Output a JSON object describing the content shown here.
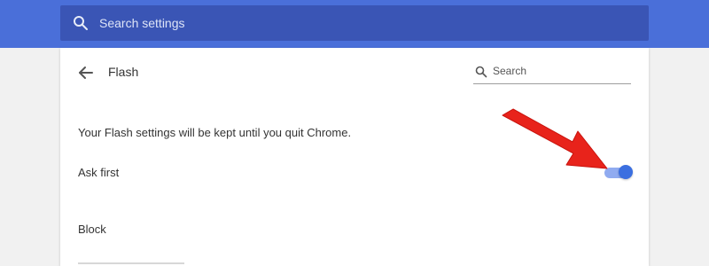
{
  "top_search": {
    "placeholder": "Search settings",
    "icon": "search-icon"
  },
  "header": {
    "back_icon": "arrow-left-icon",
    "title": "Flash",
    "search_placeholder": "Search",
    "search_icon": "search-icon"
  },
  "flash": {
    "info_text": "Your Flash settings will be kept until you quit Chrome.",
    "ask_first": {
      "label": "Ask first",
      "enabled": true
    },
    "block_section_title": "Block"
  },
  "colors": {
    "top_bar": "#4a6fd9",
    "top_search_bg": "#3a55b5",
    "toggle_track": "#90abf0",
    "toggle_thumb": "#3b6fe0",
    "annotation_arrow": "#e8231b"
  }
}
